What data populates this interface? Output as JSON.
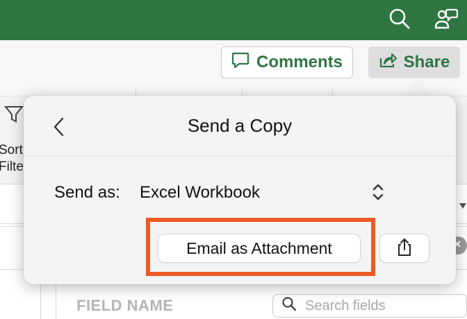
{
  "ribbon": {
    "comments_label": "Comments",
    "share_label": "Share",
    "edge_sort_label": "Sort",
    "edge_filter_label": "Filte"
  },
  "popover": {
    "title": "Send a Copy",
    "send_as_label": "Send as:",
    "send_as_value": "Excel Workbook",
    "email_attachment_label": "Email as Attachment"
  },
  "sheet": {
    "field_name_header": "FIELD NAME",
    "search_placeholder": "Search fields"
  },
  "colors": {
    "brand_green": "#2e7542",
    "highlight_orange": "#ee5a25"
  },
  "icons": [
    "search-icon",
    "chat-person-icon",
    "comment-icon",
    "share-icon",
    "chevron-left-icon",
    "stepper-icon",
    "share-sheet-icon",
    "close-icon",
    "chevron-down-icon"
  ]
}
